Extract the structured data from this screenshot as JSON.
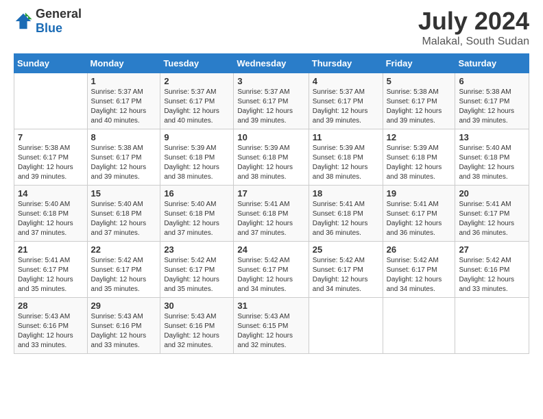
{
  "header": {
    "logo_general": "General",
    "logo_blue": "Blue",
    "month_year": "July 2024",
    "location": "Malakal, South Sudan"
  },
  "days_of_week": [
    "Sunday",
    "Monday",
    "Tuesday",
    "Wednesday",
    "Thursday",
    "Friday",
    "Saturday"
  ],
  "weeks": [
    [
      {
        "day": "",
        "sunrise": "",
        "sunset": "",
        "daylight": ""
      },
      {
        "day": "1",
        "sunrise": "Sunrise: 5:37 AM",
        "sunset": "Sunset: 6:17 PM",
        "daylight": "Daylight: 12 hours and 40 minutes."
      },
      {
        "day": "2",
        "sunrise": "Sunrise: 5:37 AM",
        "sunset": "Sunset: 6:17 PM",
        "daylight": "Daylight: 12 hours and 40 minutes."
      },
      {
        "day": "3",
        "sunrise": "Sunrise: 5:37 AM",
        "sunset": "Sunset: 6:17 PM",
        "daylight": "Daylight: 12 hours and 39 minutes."
      },
      {
        "day": "4",
        "sunrise": "Sunrise: 5:37 AM",
        "sunset": "Sunset: 6:17 PM",
        "daylight": "Daylight: 12 hours and 39 minutes."
      },
      {
        "day": "5",
        "sunrise": "Sunrise: 5:38 AM",
        "sunset": "Sunset: 6:17 PM",
        "daylight": "Daylight: 12 hours and 39 minutes."
      },
      {
        "day": "6",
        "sunrise": "Sunrise: 5:38 AM",
        "sunset": "Sunset: 6:17 PM",
        "daylight": "Daylight: 12 hours and 39 minutes."
      }
    ],
    [
      {
        "day": "7",
        "sunrise": "Sunrise: 5:38 AM",
        "sunset": "Sunset: 6:17 PM",
        "daylight": "Daylight: 12 hours and 39 minutes."
      },
      {
        "day": "8",
        "sunrise": "Sunrise: 5:38 AM",
        "sunset": "Sunset: 6:17 PM",
        "daylight": "Daylight: 12 hours and 39 minutes."
      },
      {
        "day": "9",
        "sunrise": "Sunrise: 5:39 AM",
        "sunset": "Sunset: 6:18 PM",
        "daylight": "Daylight: 12 hours and 38 minutes."
      },
      {
        "day": "10",
        "sunrise": "Sunrise: 5:39 AM",
        "sunset": "Sunset: 6:18 PM",
        "daylight": "Daylight: 12 hours and 38 minutes."
      },
      {
        "day": "11",
        "sunrise": "Sunrise: 5:39 AM",
        "sunset": "Sunset: 6:18 PM",
        "daylight": "Daylight: 12 hours and 38 minutes."
      },
      {
        "day": "12",
        "sunrise": "Sunrise: 5:39 AM",
        "sunset": "Sunset: 6:18 PM",
        "daylight": "Daylight: 12 hours and 38 minutes."
      },
      {
        "day": "13",
        "sunrise": "Sunrise: 5:40 AM",
        "sunset": "Sunset: 6:18 PM",
        "daylight": "Daylight: 12 hours and 38 minutes."
      }
    ],
    [
      {
        "day": "14",
        "sunrise": "Sunrise: 5:40 AM",
        "sunset": "Sunset: 6:18 PM",
        "daylight": "Daylight: 12 hours and 37 minutes."
      },
      {
        "day": "15",
        "sunrise": "Sunrise: 5:40 AM",
        "sunset": "Sunset: 6:18 PM",
        "daylight": "Daylight: 12 hours and 37 minutes."
      },
      {
        "day": "16",
        "sunrise": "Sunrise: 5:40 AM",
        "sunset": "Sunset: 6:18 PM",
        "daylight": "Daylight: 12 hours and 37 minutes."
      },
      {
        "day": "17",
        "sunrise": "Sunrise: 5:41 AM",
        "sunset": "Sunset: 6:18 PM",
        "daylight": "Daylight: 12 hours and 37 minutes."
      },
      {
        "day": "18",
        "sunrise": "Sunrise: 5:41 AM",
        "sunset": "Sunset: 6:18 PM",
        "daylight": "Daylight: 12 hours and 36 minutes."
      },
      {
        "day": "19",
        "sunrise": "Sunrise: 5:41 AM",
        "sunset": "Sunset: 6:17 PM",
        "daylight": "Daylight: 12 hours and 36 minutes."
      },
      {
        "day": "20",
        "sunrise": "Sunrise: 5:41 AM",
        "sunset": "Sunset: 6:17 PM",
        "daylight": "Daylight: 12 hours and 36 minutes."
      }
    ],
    [
      {
        "day": "21",
        "sunrise": "Sunrise: 5:41 AM",
        "sunset": "Sunset: 6:17 PM",
        "daylight": "Daylight: 12 hours and 35 minutes."
      },
      {
        "day": "22",
        "sunrise": "Sunrise: 5:42 AM",
        "sunset": "Sunset: 6:17 PM",
        "daylight": "Daylight: 12 hours and 35 minutes."
      },
      {
        "day": "23",
        "sunrise": "Sunrise: 5:42 AM",
        "sunset": "Sunset: 6:17 PM",
        "daylight": "Daylight: 12 hours and 35 minutes."
      },
      {
        "day": "24",
        "sunrise": "Sunrise: 5:42 AM",
        "sunset": "Sunset: 6:17 PM",
        "daylight": "Daylight: 12 hours and 34 minutes."
      },
      {
        "day": "25",
        "sunrise": "Sunrise: 5:42 AM",
        "sunset": "Sunset: 6:17 PM",
        "daylight": "Daylight: 12 hours and 34 minutes."
      },
      {
        "day": "26",
        "sunrise": "Sunrise: 5:42 AM",
        "sunset": "Sunset: 6:17 PM",
        "daylight": "Daylight: 12 hours and 34 minutes."
      },
      {
        "day": "27",
        "sunrise": "Sunrise: 5:42 AM",
        "sunset": "Sunset: 6:16 PM",
        "daylight": "Daylight: 12 hours and 33 minutes."
      }
    ],
    [
      {
        "day": "28",
        "sunrise": "Sunrise: 5:43 AM",
        "sunset": "Sunset: 6:16 PM",
        "daylight": "Daylight: 12 hours and 33 minutes."
      },
      {
        "day": "29",
        "sunrise": "Sunrise: 5:43 AM",
        "sunset": "Sunset: 6:16 PM",
        "daylight": "Daylight: 12 hours and 33 minutes."
      },
      {
        "day": "30",
        "sunrise": "Sunrise: 5:43 AM",
        "sunset": "Sunset: 6:16 PM",
        "daylight": "Daylight: 12 hours and 32 minutes."
      },
      {
        "day": "31",
        "sunrise": "Sunrise: 5:43 AM",
        "sunset": "Sunset: 6:15 PM",
        "daylight": "Daylight: 12 hours and 32 minutes."
      },
      {
        "day": "",
        "sunrise": "",
        "sunset": "",
        "daylight": ""
      },
      {
        "day": "",
        "sunrise": "",
        "sunset": "",
        "daylight": ""
      },
      {
        "day": "",
        "sunrise": "",
        "sunset": "",
        "daylight": ""
      }
    ]
  ]
}
